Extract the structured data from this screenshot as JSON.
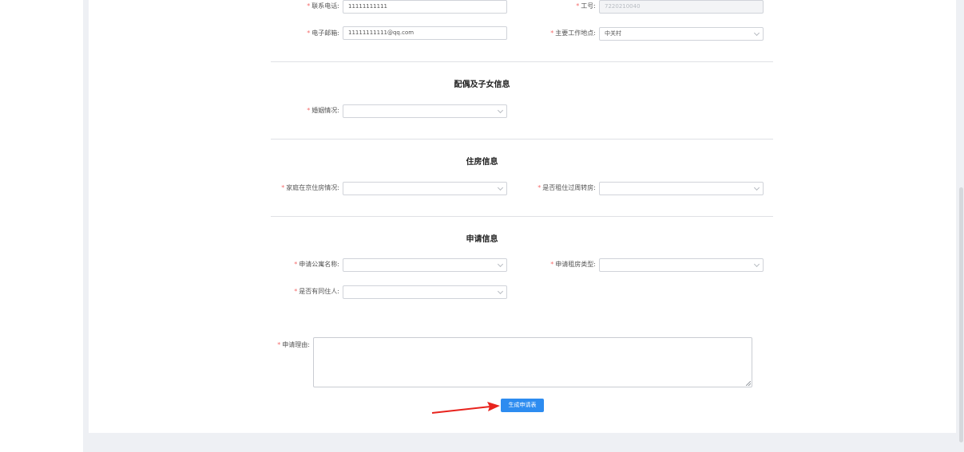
{
  "contact": {
    "phone_label": "联系电话:",
    "phone_value": "11111111111",
    "employee_id_label": "工号:",
    "employee_id_value": "7220210040",
    "email_label": "电子邮箱:",
    "email_value": "11111111111@qq.com",
    "work_location_label": "主要工作地点:",
    "work_location_value": "中关村"
  },
  "spouse_section": {
    "title": "配偶及子女信息",
    "marital_label": "婚姻情况:",
    "marital_value": ""
  },
  "housing_section": {
    "title": "住房信息",
    "family_housing_label": "家庭在京住房情况:",
    "family_housing_value": "",
    "rented_turnover_label": "是否租住过周转房:",
    "rented_turnover_value": ""
  },
  "apply_section": {
    "title": "申请信息",
    "apartment_label": "申请公寓名称:",
    "apartment_value": "",
    "room_type_label": "申请租房类型:",
    "room_type_value": "",
    "cohabitant_label": "是否有同住人:",
    "cohabitant_value": "",
    "reason_label": "申请理由:",
    "reason_value": "",
    "submit_label": "生成申请表"
  },
  "required_mark": "*",
  "colors": {
    "primary": "#2d8cf0",
    "required": "#f56c6c",
    "annotation_arrow": "#e8231d"
  }
}
